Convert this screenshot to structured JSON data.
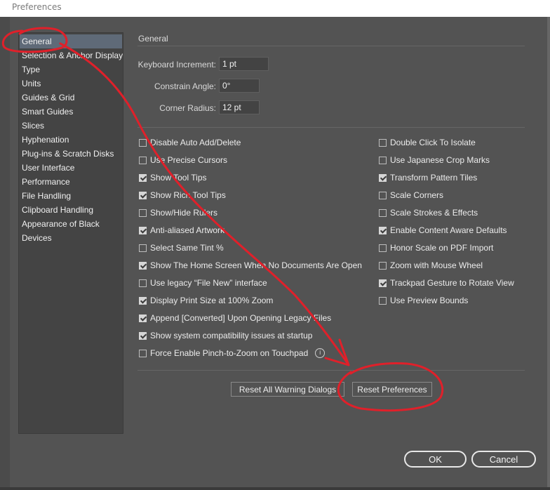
{
  "window": {
    "title": "Preferences"
  },
  "sidebar": {
    "items": [
      {
        "label": "General",
        "selected": true
      },
      {
        "label": "Selection & Anchor Display"
      },
      {
        "label": "Type"
      },
      {
        "label": "Units"
      },
      {
        "label": "Guides & Grid"
      },
      {
        "label": "Smart Guides"
      },
      {
        "label": "Slices"
      },
      {
        "label": "Hyphenation"
      },
      {
        "label": "Plug-ins & Scratch Disks"
      },
      {
        "label": "User Interface"
      },
      {
        "label": "Performance"
      },
      {
        "label": "File Handling"
      },
      {
        "label": "Clipboard Handling"
      },
      {
        "label": "Appearance of Black"
      },
      {
        "label": "Devices"
      }
    ]
  },
  "general": {
    "section_title": "General",
    "keyboard_increment": {
      "label": "Keyboard Increment:",
      "value": "1 pt"
    },
    "constrain_angle": {
      "label": "Constrain Angle:",
      "value": "0°"
    },
    "corner_radius": {
      "label": "Corner Radius:",
      "value": "12 pt"
    },
    "left_options": [
      {
        "label": "Disable Auto Add/Delete",
        "checked": false
      },
      {
        "label": "Use Precise Cursors",
        "checked": false
      },
      {
        "label": "Show Tool Tips",
        "checked": true
      },
      {
        "label": "Show Rich Tool Tips",
        "checked": true
      },
      {
        "label": "Show/Hide Rulers",
        "checked": false
      },
      {
        "label": "Anti-aliased Artwork",
        "checked": true
      },
      {
        "label": "Select Same Tint %",
        "checked": false
      },
      {
        "label": "Show The Home Screen When No Documents Are Open",
        "checked": true
      },
      {
        "label": "Use legacy “File New” interface",
        "checked": false
      },
      {
        "label": "Display Print Size at 100% Zoom",
        "checked": true
      },
      {
        "label": "Append [Converted] Upon Opening Legacy Files",
        "checked": true
      },
      {
        "label": "Show system compatibility issues at startup",
        "checked": true
      },
      {
        "label": "Force Enable Pinch-to-Zoom on Touchpad",
        "checked": false
      }
    ],
    "right_options": [
      {
        "label": "Double Click To Isolate",
        "checked": false
      },
      {
        "label": "Use Japanese Crop Marks",
        "checked": false
      },
      {
        "label": "Transform Pattern Tiles",
        "checked": true
      },
      {
        "label": "Scale Corners",
        "checked": false
      },
      {
        "label": "Scale Strokes & Effects",
        "checked": false
      },
      {
        "label": "Enable Content Aware Defaults",
        "checked": true
      },
      {
        "label": "Honor Scale on PDF Import",
        "checked": false
      },
      {
        "label": "Zoom with Mouse Wheel",
        "checked": false
      },
      {
        "label": "Trackpad Gesture to Rotate View",
        "checked": true
      },
      {
        "label": "Use Preview Bounds",
        "checked": false
      }
    ],
    "info_icon": "info-icon",
    "reset_warning_dialogs_label": "Reset All Warning Dialogs",
    "reset_preferences_label": "Reset Preferences"
  },
  "footer": {
    "ok_label": "OK",
    "cancel_label": "Cancel"
  },
  "colors": {
    "annotation": "#e0202a",
    "panel_bg": "#535353",
    "selected_item": "#5f6a78"
  }
}
